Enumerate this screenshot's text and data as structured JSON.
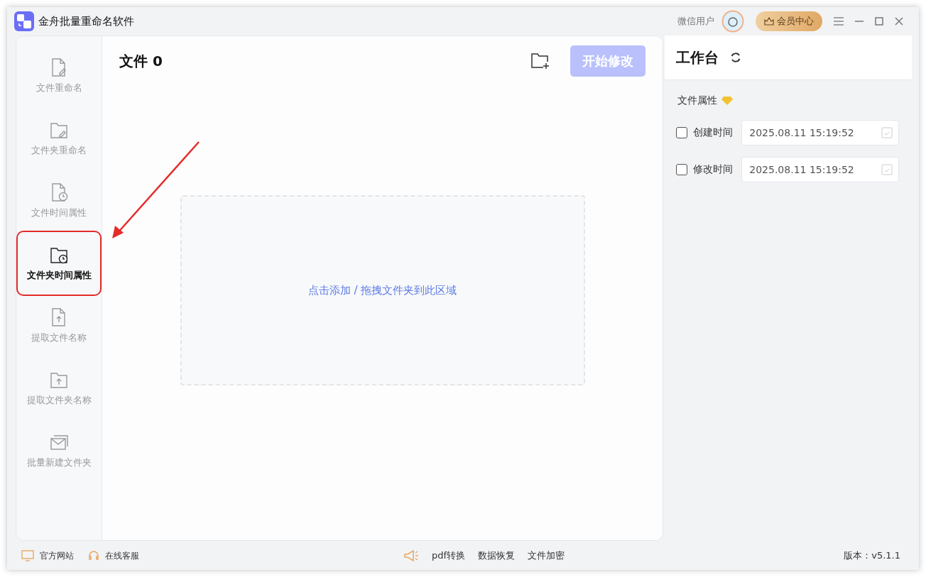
{
  "window": {
    "title": "金舟批量重命名软件",
    "user": "微信用户",
    "vip_button": "会员中心"
  },
  "sidebar": {
    "items": [
      {
        "label": "文件重命名",
        "kind": "file-edit",
        "selected": false
      },
      {
        "label": "文件夹重命名",
        "kind": "folder-edit",
        "selected": false
      },
      {
        "label": "文件时间属性",
        "kind": "file-clock",
        "selected": false
      },
      {
        "label": "文件夹时间属性",
        "kind": "folder-clock",
        "selected": true
      },
      {
        "label": "提取文件名称",
        "kind": "file-upload",
        "selected": false
      },
      {
        "label": "提取文件夹名称",
        "kind": "folder-upload",
        "selected": false
      },
      {
        "label": "批量新建文件夹",
        "kind": "mail",
        "selected": false
      }
    ]
  },
  "file_panel": {
    "title": "文件 0",
    "start_button": "开始修改",
    "start_disabled": true,
    "drop_zone": "点击添加 / 拖拽文件夹到此区域"
  },
  "workbench": {
    "title": "工作台",
    "section": "文件属性",
    "fields": [
      {
        "label": "创建时间",
        "checked": false,
        "value": "2025.08.11 15:19:52"
      },
      {
        "label": "修改时间",
        "checked": false,
        "value": "2025.08.11 15:19:52"
      }
    ]
  },
  "status_bar": {
    "left": [
      "官方网站",
      "在线客服"
    ],
    "center": [
      "pdf转换",
      "数据恢复",
      "文件加密"
    ],
    "version": "版本：v5.1.1"
  }
}
